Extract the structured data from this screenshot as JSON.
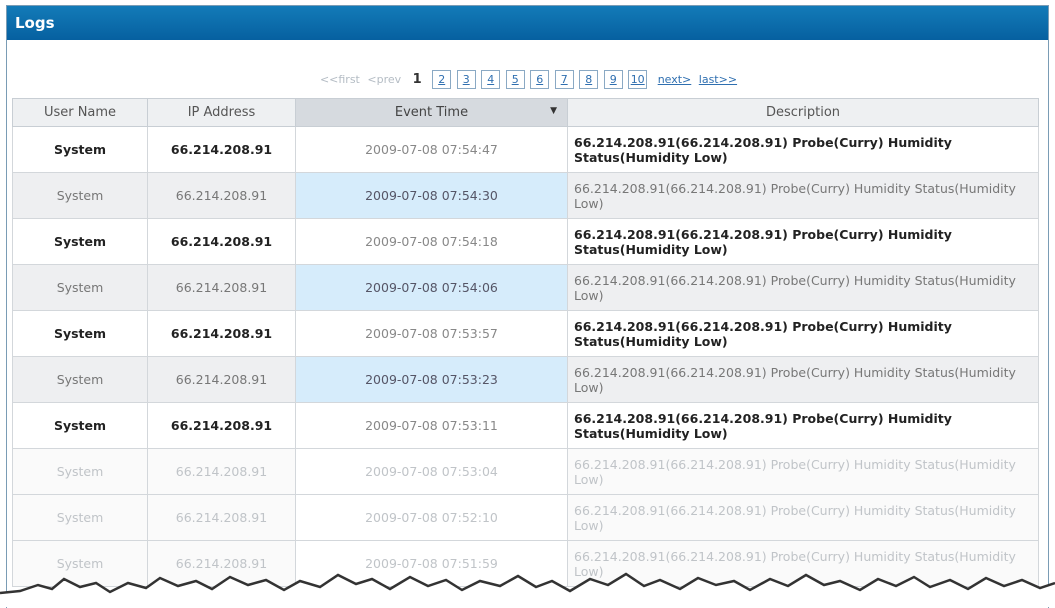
{
  "panel": {
    "title": "Logs"
  },
  "pagination": {
    "first_label": "<<first",
    "prev_label": "<prev",
    "current": "1",
    "pages": [
      "2",
      "3",
      "4",
      "5",
      "6",
      "7",
      "8",
      "9",
      "10"
    ],
    "next_label": "next>",
    "last_label": "last>>"
  },
  "table": {
    "columns": [
      "User Name",
      "IP Address",
      "Event Time",
      "Description"
    ],
    "sorted_column": "Event Time",
    "rows": [
      {
        "user": "System",
        "ip": "66.214.208.91",
        "time": "2009-07-08 07:54:47",
        "desc": "66.214.208.91(66.214.208.91) Probe(Curry) Humidity Status(Humidity Low)"
      },
      {
        "user": "System",
        "ip": "66.214.208.91",
        "time": "2009-07-08 07:54:30",
        "desc": "66.214.208.91(66.214.208.91) Probe(Curry) Humidity Status(Humidity Low)"
      },
      {
        "user": "System",
        "ip": "66.214.208.91",
        "time": "2009-07-08 07:54:18",
        "desc": "66.214.208.91(66.214.208.91) Probe(Curry) Humidity Status(Humidity Low)"
      },
      {
        "user": "System",
        "ip": "66.214.208.91",
        "time": "2009-07-08 07:54:06",
        "desc": "66.214.208.91(66.214.208.91) Probe(Curry) Humidity Status(Humidity Low)"
      },
      {
        "user": "System",
        "ip": "66.214.208.91",
        "time": "2009-07-08 07:53:57",
        "desc": "66.214.208.91(66.214.208.91) Probe(Curry) Humidity Status(Humidity Low)"
      },
      {
        "user": "System",
        "ip": "66.214.208.91",
        "time": "2009-07-08 07:53:23",
        "desc": "66.214.208.91(66.214.208.91) Probe(Curry) Humidity Status(Humidity Low)"
      },
      {
        "user": "System",
        "ip": "66.214.208.91",
        "time": "2009-07-08 07:53:11",
        "desc": "66.214.208.91(66.214.208.91) Probe(Curry) Humidity Status(Humidity Low)"
      },
      {
        "user": "System",
        "ip": "66.214.208.91",
        "time": "2009-07-08 07:53:04",
        "desc": "66.214.208.91(66.214.208.91) Probe(Curry) Humidity Status(Humidity Low)"
      },
      {
        "user": "System",
        "ip": "66.214.208.91",
        "time": "2009-07-08 07:52:10",
        "desc": "66.214.208.91(66.214.208.91) Probe(Curry) Humidity Status(Humidity Low)"
      },
      {
        "user": "System",
        "ip": "66.214.208.91",
        "time": "2009-07-08 07:51:59",
        "desc": "66.214.208.91(66.214.208.91) Probe(Curry) Humidity Status(Humidity Low)"
      }
    ]
  },
  "colors": {
    "titlebar": "#0a6ba8",
    "selected_time": "#d6ecfb",
    "link": "#2f6fb0"
  }
}
